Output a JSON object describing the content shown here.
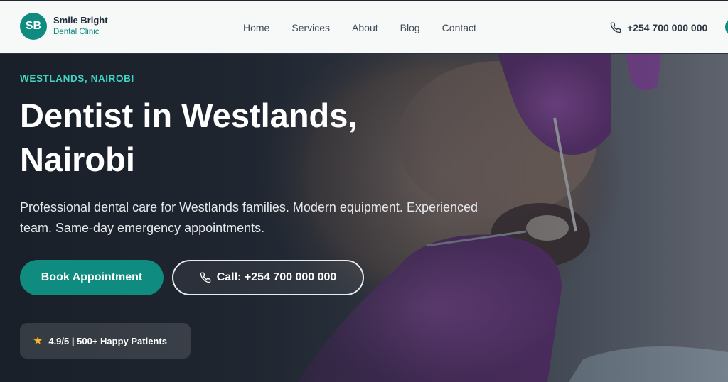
{
  "header": {
    "logo_initials": "SB",
    "brand_name": "Smile Bright",
    "brand_sub": "Dental Clinic",
    "nav": [
      {
        "label": "Home"
      },
      {
        "label": "Services"
      },
      {
        "label": "About"
      },
      {
        "label": "Blog"
      },
      {
        "label": "Contact"
      }
    ],
    "phone": "+254 700 000 000"
  },
  "hero": {
    "eyebrow": "WESTLANDS, NAIROBI",
    "title": "Dentist in Westlands, Nairobi",
    "description": "Professional dental care for Westlands families. Modern equipment. Experienced team. Same-day emergency appointments.",
    "primary_button": "Book Appointment",
    "call_button": "Call: +254 700 000 000",
    "rating_text": "4.9/5 | 500+ Happy Patients"
  },
  "colors": {
    "accent": "#0f8c7f",
    "eyebrow": "#3ed6c3",
    "star": "#f5b524",
    "glove": "#7a3f8f"
  },
  "icons": [
    "phone-icon",
    "star-icon"
  ]
}
